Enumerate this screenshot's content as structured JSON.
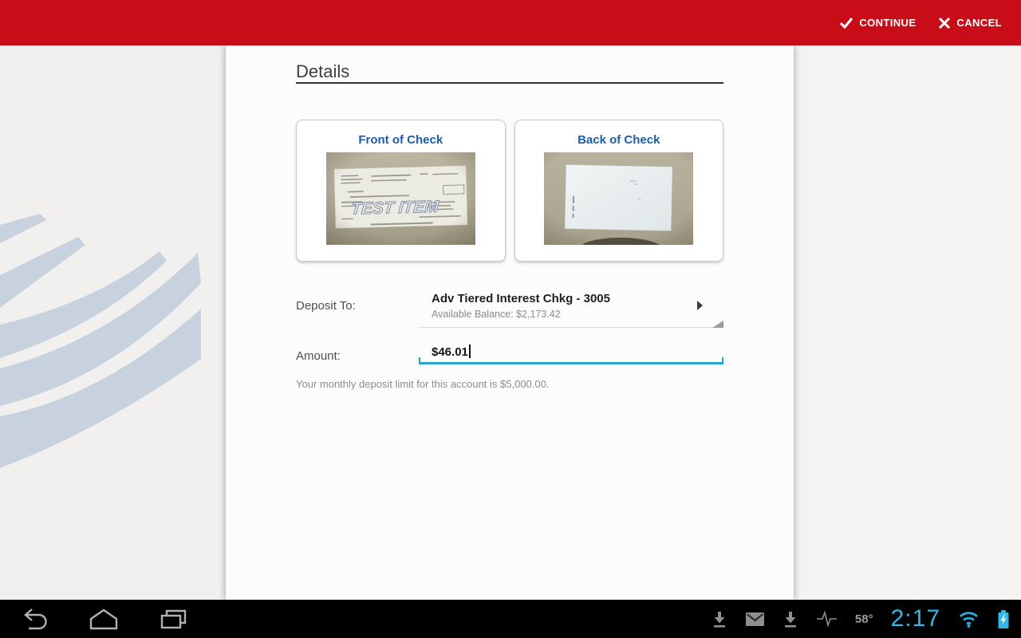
{
  "app_bar": {
    "continue_label": "CONTINUE",
    "cancel_label": "CANCEL",
    "background_color": "#c90d18"
  },
  "page": {
    "title": "Details"
  },
  "checks": {
    "front": {
      "label": "Front of Check",
      "watermark": "TEST ITEM"
    },
    "back": {
      "label": "Back of Check"
    }
  },
  "deposit_to": {
    "label": "Deposit To:",
    "account_name": "Adv Tiered Interest Chkg - 3005",
    "available_balance": "Available Balance: $2,173.42"
  },
  "amount": {
    "label": "Amount:",
    "value": "$46.01",
    "underline_color": "#28a5c8"
  },
  "limit_note": "Your monthly deposit limit for this account is $5,000.00.",
  "status_bar": {
    "temperature": "58°",
    "time": "2:17",
    "accent_color": "#35b6e5",
    "icons": [
      "download",
      "gmail",
      "download",
      "signal-activity",
      "wifi",
      "battery-charging"
    ]
  },
  "nav_bar": {
    "buttons": [
      "back",
      "home",
      "recent-apps"
    ]
  },
  "brand": {
    "flag_stripe_color": "#c8d2de",
    "card_title_color": "#1a5da8"
  }
}
